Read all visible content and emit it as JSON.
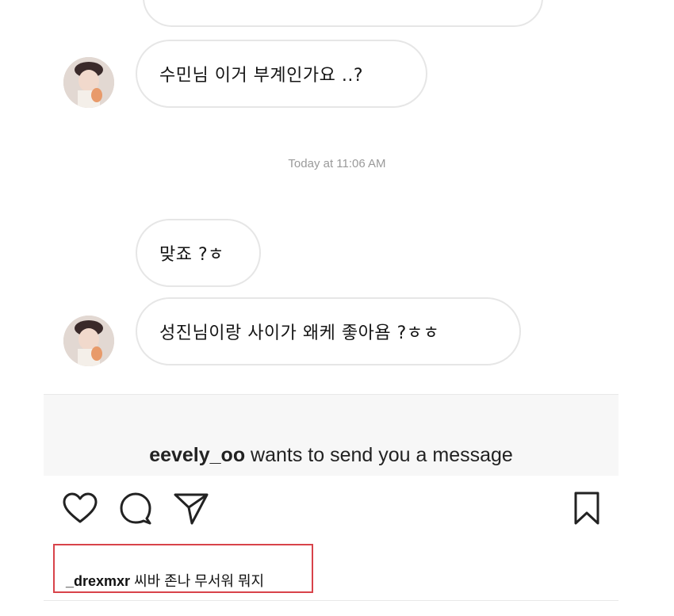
{
  "messages": [
    {
      "text": "수민님 이거 부계인가요 ..?"
    },
    {
      "text": "맞죠 ?ㅎ"
    },
    {
      "text": "성진님이랑 사이가 왜케 좋아욤 ?ㅎㅎ"
    }
  ],
  "timestamp": "Today at 11:06 AM",
  "request": {
    "username": "eevely_oo",
    "text": " wants to send you a message"
  },
  "icons": {
    "like": "heart-icon",
    "comment": "comment-icon",
    "share": "send-icon",
    "save": "bookmark-icon"
  },
  "comment": {
    "username": "_drexmxr",
    "text": " 씨바 존나 무서워 뭐지"
  },
  "colors": {
    "bubble_border": "#e6e6e6",
    "timestamp": "#9a9a9a",
    "highlight_box": "#d8434a",
    "request_bg": "#f7f7f7"
  }
}
